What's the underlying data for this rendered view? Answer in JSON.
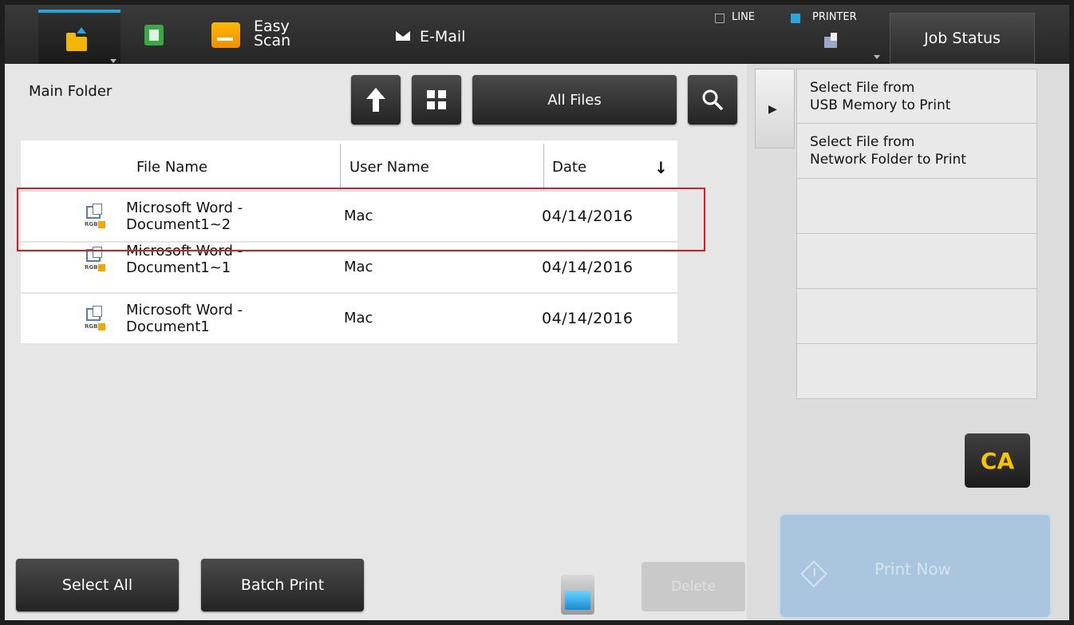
{
  "topbar": {
    "easy_scan_label": "Easy\nScan",
    "email_label": "E-Mail",
    "line_label": "LINE",
    "printer_label": "PRINTER",
    "job_status_label": "Job Status"
  },
  "main": {
    "folder_title": "Main Folder",
    "filter_label": "All Files",
    "columns": [
      "File Name",
      "User Name",
      "Date"
    ],
    "rows": [
      {
        "file_name": "Microsoft Word -\nDocument1~2",
        "user_name": "Mac",
        "date": "04/14/2016"
      },
      {
        "file_name": "Microsoft Word -\nDocument1~1",
        "user_name": "Mac",
        "date": "04/14/2016"
      },
      {
        "file_name": "Microsoft Word -\nDocument1",
        "user_name": "Mac",
        "date": "04/14/2016"
      }
    ],
    "sort_indicator": "↓"
  },
  "right_panel": {
    "items": [
      "Select File from\nUSB Memory to Print",
      "Select File from\nNetwork Folder to Print",
      "",
      "",
      "",
      ""
    ],
    "ca_label": "CA",
    "print_now_label": "Print Now"
  },
  "bottom": {
    "select_all_label": "Select All",
    "batch_print_label": "Batch Print",
    "delete_label": "Delete"
  },
  "colors": {
    "accent_blue": "#2aa3d8",
    "highlight_red": "#e0191e",
    "ca_yellow": "#f7c400"
  }
}
